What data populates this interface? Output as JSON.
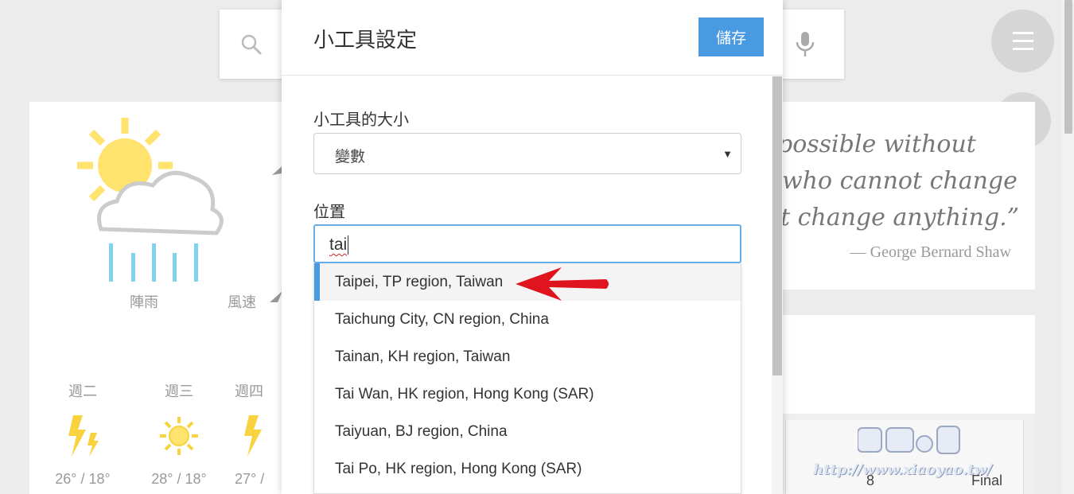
{
  "search": {},
  "weather": {
    "condition": "陣雨",
    "wind_label": "風速",
    "forecast": [
      {
        "day": "週二",
        "icon": "lightning-icon",
        "temp": "26° / 18°"
      },
      {
        "day": "週三",
        "icon": "sun-icon",
        "temp": "28° / 18°"
      },
      {
        "day": "週四",
        "icon": "lightning-icon",
        "temp": "27° /"
      }
    ]
  },
  "quote": {
    "line1": "possible without",
    "line2": "who cannot change",
    "line3": "t change anything.”",
    "author": "— George Bernard Shaw"
  },
  "score": {
    "number": "8",
    "status": "Final"
  },
  "watermark": {
    "url": "http://www.xiaoyao.tw/"
  },
  "dialog": {
    "title": "小工具設定",
    "save_label": "儲存",
    "size_label": "小工具的大小",
    "size_value": "變數",
    "location_label": "位置",
    "location_value": "tai",
    "suggestions": [
      "Taipei, TP region, Taiwan",
      "Taichung City, CN region, China",
      "Tainan, KH region, Taiwan",
      "Tai Wan, HK region, Hong Kong (SAR)",
      "Taiyuan, BJ region, China",
      "Tai Po, HK region, Hong Kong (SAR)"
    ]
  },
  "colors": {
    "accent": "#4a9ae1",
    "annotation": "#e0141e"
  }
}
